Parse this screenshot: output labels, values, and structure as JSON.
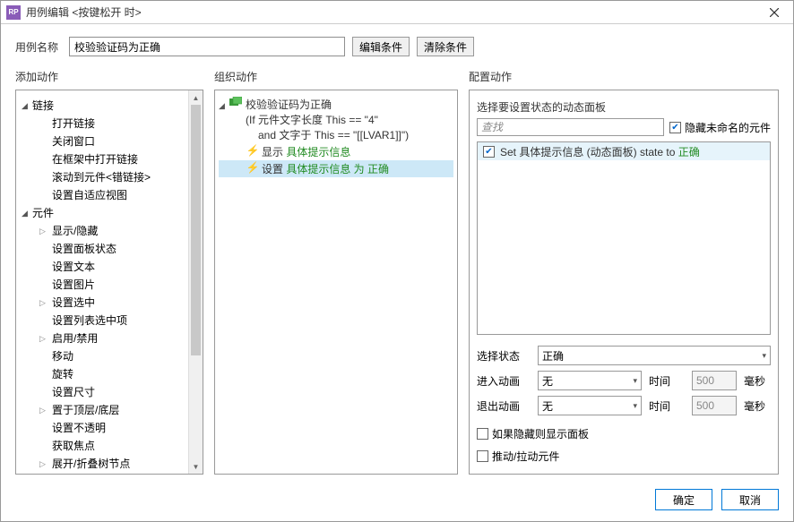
{
  "title": "用例编辑 <按键松开 时>",
  "header": {
    "name_label": "用例名称",
    "name_value": "校验验证码为正确",
    "edit_cond": "编辑条件",
    "clear_cond": "清除条件"
  },
  "col_titles": {
    "left": "添加动作",
    "mid": "组织动作",
    "right": "配置动作"
  },
  "left_tree": {
    "links": {
      "label": "链接",
      "items": [
        "打开链接",
        "关闭窗口",
        "在框架中打开链接",
        "滚动到元件<错链接>",
        "设置自适应视图"
      ]
    },
    "widgets": {
      "label": "元件",
      "items": [
        {
          "t": "显示/隐藏",
          "c": true
        },
        {
          "t": "设置面板状态",
          "c": false
        },
        {
          "t": "设置文本",
          "c": false
        },
        {
          "t": "设置图片",
          "c": false
        },
        {
          "t": "设置选中",
          "c": true
        },
        {
          "t": "设置列表选中项",
          "c": false
        },
        {
          "t": "启用/禁用",
          "c": true
        },
        {
          "t": "移动",
          "c": false
        },
        {
          "t": "旋转",
          "c": false
        },
        {
          "t": "设置尺寸",
          "c": false
        },
        {
          "t": "置于顶层/底层",
          "c": true
        },
        {
          "t": "设置不透明",
          "c": false
        },
        {
          "t": "获取焦点",
          "c": false
        },
        {
          "t": "展开/折叠树节点",
          "c": true
        }
      ]
    }
  },
  "mid": {
    "case_name": "校验验证码为正确",
    "cond1": "(If 元件文字长度 This == \"4\"",
    "cond2": "and 文字于 This == \"[[LVAR1]]\")",
    "a1_pre": "显示 ",
    "a1_green": "具体提示信息",
    "a2_pre": "设置 ",
    "a2_green": "具体提示信息 为 正确"
  },
  "right": {
    "section": "选择要设置状态的动态面板",
    "search_ph": "查找",
    "hide_unnamed": "隐藏未命名的元件",
    "item_pre": "Set 具体提示信息 (动态面板) state to ",
    "item_green": "正确",
    "state_label": "选择状态",
    "state_value": "正确",
    "anim_in": "进入动画",
    "anim_out": "退出动画",
    "anim_none": "无",
    "time_label": "时间",
    "time_val": "500",
    "ms": "毫秒",
    "opt1": "如果隐藏则显示面板",
    "opt2": "推动/拉动元件"
  },
  "footer": {
    "ok": "确定",
    "cancel": "取消"
  }
}
